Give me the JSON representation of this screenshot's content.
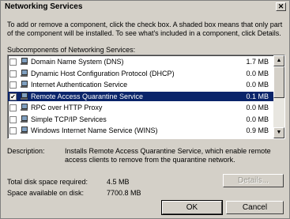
{
  "window": {
    "title": "Networking Services",
    "close_glyph": "✕"
  },
  "description": "To add or remove a component, click the check box. A shaded box means that only part of the component will be installed. To see what's included in a component, click Details.",
  "subcomponents_label": "Subcomponents of Networking Services:",
  "components": [
    {
      "checked": false,
      "name": "Domain Name System (DNS)",
      "size": "1.7 MB",
      "selected": false
    },
    {
      "checked": false,
      "name": "Dynamic Host Configuration Protocol (DHCP)",
      "size": "0.0 MB",
      "selected": false
    },
    {
      "checked": false,
      "name": "Internet Authentication Service",
      "size": "0.0 MB",
      "selected": false
    },
    {
      "checked": true,
      "name": "Remote Access Quarantine Service",
      "size": "0.1 MB",
      "selected": true
    },
    {
      "checked": false,
      "name": "RPC over HTTP Proxy",
      "size": "0.0 MB",
      "selected": false
    },
    {
      "checked": false,
      "name": "Simple TCP/IP Services",
      "size": "0.0 MB",
      "selected": false
    },
    {
      "checked": false,
      "name": "Windows Internet Name Service (WINS)",
      "size": "0.9 MB",
      "selected": false
    }
  ],
  "component_check_glyph": "✔",
  "description_label": "Description:",
  "description_text": "Installs Remote Access Quarantine Service, which enable remote access clients to remove from the quarantine network.",
  "disk": {
    "required_label": "Total disk space required:",
    "required_value": "4.5 MB",
    "available_label": "Space available on disk:",
    "available_value": "7700.8 MB"
  },
  "buttons": {
    "details": "Details...",
    "ok": "OK",
    "cancel": "Cancel"
  },
  "scroll": {
    "up_glyph": "▲",
    "down_glyph": "▼"
  },
  "colors": {
    "selection": "#0a246a",
    "dialog_bg": "#d4d0c8"
  }
}
